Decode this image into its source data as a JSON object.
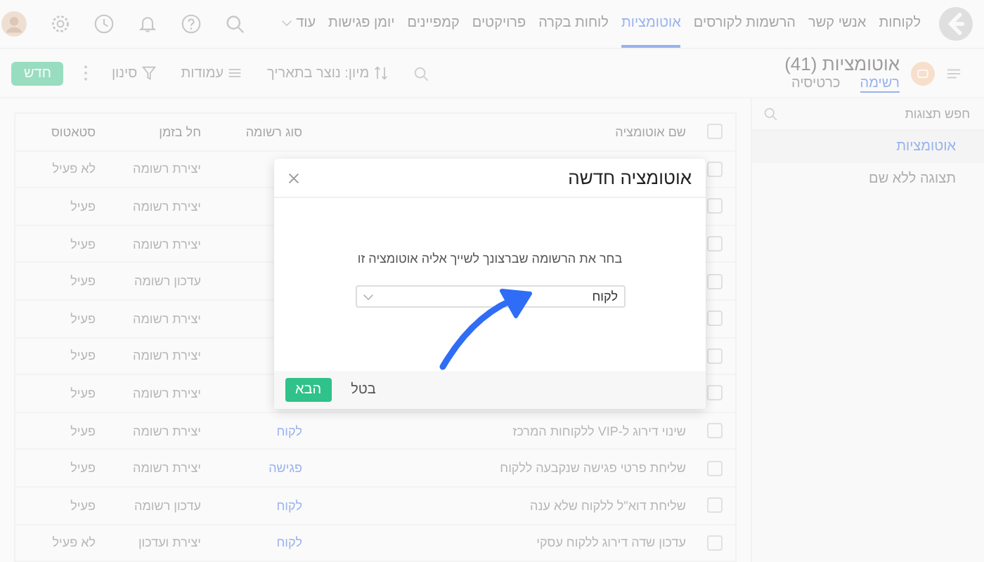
{
  "nav": {
    "items": [
      {
        "label": "לקוחות",
        "selected": false
      },
      {
        "label": "אנשי קשר",
        "selected": false
      },
      {
        "label": "הרשמות לקורסים",
        "selected": false
      },
      {
        "label": "אוטומציות",
        "selected": true
      },
      {
        "label": "לוחות בקרה",
        "selected": false
      },
      {
        "label": "פרויקטים",
        "selected": false
      },
      {
        "label": "קמפיינים",
        "selected": false
      },
      {
        "label": "יומן פגישות",
        "selected": false
      }
    ],
    "more": "עוד"
  },
  "header": {
    "title": "אוטומציות (41)",
    "tabs": [
      {
        "label": "רשימה",
        "selected": true
      },
      {
        "label": "כרטיסיה",
        "selected": false
      }
    ],
    "sort": "מיון: נוצר בתאריך",
    "columns": "עמודות",
    "filter": "סינון",
    "new_button": "חדש"
  },
  "sidebar": {
    "search": {
      "placeholder": "חפש תצוגות"
    },
    "items": [
      {
        "label": "אוטומציות",
        "selected": true
      },
      {
        "label": "תצוגה ללא שם",
        "selected": false
      }
    ]
  },
  "table": {
    "all_checked": false,
    "columns": [
      "שם אוטומציה",
      "סוג רשומה",
      "חל בזמן",
      "סטאטוס"
    ],
    "rows": [
      {
        "checked": false,
        "trigger": "יצירת רשומה",
        "status": "לא פעיל"
      },
      {
        "checked": false,
        "trigger": "יצירת רשומה",
        "status": "פעיל"
      },
      {
        "checked": false,
        "trigger": "יצירת רשומה",
        "status": "פעיל"
      },
      {
        "checked": false,
        "trigger": "עדכון רשומה",
        "status": "פעיל"
      },
      {
        "checked": false,
        "trigger": "יצירת רשומה",
        "status": "פעיל"
      },
      {
        "checked": false,
        "trigger": "יצירת רשומה",
        "status": "פעיל"
      },
      {
        "checked": false,
        "trigger": "יצירת רשומה",
        "status": "פעיל"
      },
      {
        "checked": false,
        "name": "שינוי דירוג ל-VIP ללקוחות המרכז",
        "type": "לקוח",
        "trigger": "יצירת רשומה",
        "status": "פעיל"
      },
      {
        "checked": false,
        "name": "שליחת פרטי פגישה שנקבעה ללקוח",
        "type": "פגישה",
        "trigger": "יצירת רשומה",
        "status": "פעיל"
      },
      {
        "checked": false,
        "name": "שליחת דוא\"ל ללקוח שלא ענה",
        "type": "לקוח",
        "trigger": "עדכון רשומה",
        "status": "פעיל"
      },
      {
        "checked": false,
        "name": "עדכון שדה דירוג ללקוח עסקי",
        "type": "לקוח",
        "trigger": "יצירת ועדכון",
        "status": "לא פעיל"
      }
    ]
  },
  "modal": {
    "title": "אוטומציה חדשה",
    "prompt": "בחר את הרשומה שברצונך לשייך אליה אוטומציה זו",
    "select_value": "לקוח",
    "cancel": "בטל",
    "next": "הבא"
  }
}
